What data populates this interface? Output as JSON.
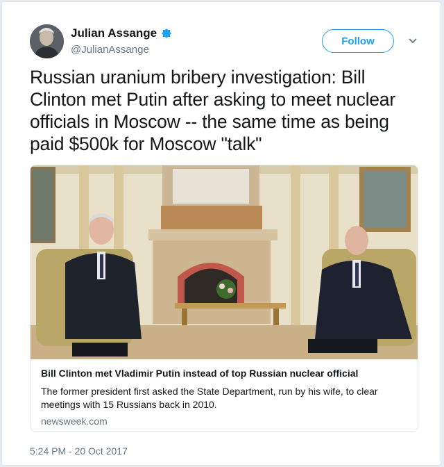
{
  "author": {
    "name": "Julian Assange",
    "handle": "@JulianAssange",
    "verified_icon": "verified-badge-icon",
    "avatar_icon": "profile-avatar"
  },
  "actions": {
    "follow_label": "Follow",
    "menu_icon": "chevron-down-icon"
  },
  "tweet": {
    "text": "Russian uranium bribery investigation: Bill Clinton met Putin after asking to meet nuclear officials in Moscow -- the same time as being paid $500k for Moscow \"talk\"",
    "timestamp": "5:24 PM - 20 Oct 2017"
  },
  "card": {
    "title": "Bill Clinton met Vladimir Putin instead of top Russian nuclear official",
    "description": "The former president first asked the State Department, run by his wife, to clear meetings with 15 Russians back in 2010.",
    "domain": "newsweek.com"
  },
  "colors": {
    "accent": "#1da1f2",
    "text": "#14171a",
    "muted": "#657786",
    "border": "#e1e8ed"
  }
}
